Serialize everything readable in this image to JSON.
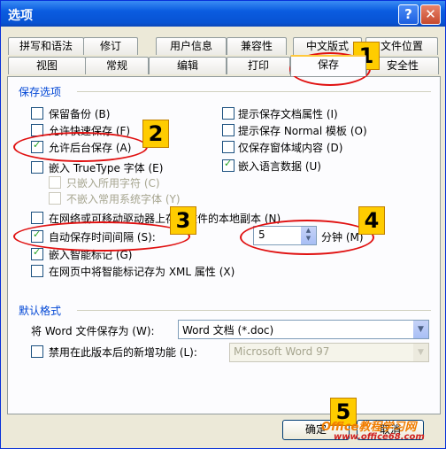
{
  "window": {
    "title": "选项",
    "help": "?",
    "close": "✕"
  },
  "tabs_row1": [
    "拼写和语法",
    "修订",
    "用户信息",
    "兼容性",
    "中文版式",
    "文件位置"
  ],
  "tabs_row2": [
    "视图",
    "常规",
    "编辑",
    "打印",
    "保存",
    "安全性"
  ],
  "save_options": {
    "header": "保存选项",
    "left": [
      {
        "label": "保留备份 (B)",
        "checked": false,
        "disabled": false
      },
      {
        "label": "允许快速保存 (F)",
        "checked": false,
        "disabled": false
      },
      {
        "label": "允许后台保存 (A)",
        "checked": true,
        "disabled": false
      },
      {
        "label": "嵌入 TrueType 字体 (E)",
        "checked": false,
        "disabled": false
      },
      {
        "label": "只嵌入所用字符 (C)",
        "checked": false,
        "disabled": true
      },
      {
        "label": "不嵌入常用系统字体 (Y)",
        "checked": false,
        "disabled": true
      }
    ],
    "right": [
      {
        "label": "提示保存文档属性 (I)",
        "checked": false
      },
      {
        "label": "提示保存 Normal 模板 (O)",
        "checked": false
      },
      {
        "label": "仅保存窗体域内容 (D)",
        "checked": false
      },
      {
        "label": "嵌入语言数据 (U)",
        "checked": true
      }
    ],
    "network_copy": {
      "label": "在网络或可移动驱动器上存储文件的本地副本 (N)",
      "checked": false
    },
    "autosave": {
      "label": "自动保存时间间隔 (S):",
      "checked": true,
      "value": "5",
      "unit": "分钟 (M)"
    },
    "smart_tags": {
      "label": "嵌入智能标记 (G)",
      "checked": true
    },
    "xml_tags": {
      "label": "在网页中将智能标记存为 XML 属性 (X)",
      "checked": false
    }
  },
  "default_format": {
    "header": "默认格式",
    "save_as_label": "将 Word 文件保存为 (W):",
    "save_as_value": "Word 文档 (*.doc)",
    "disable_label": "禁用在此版本后的新增功能 (L):",
    "disable_value": "Microsoft Word 97",
    "disable_checked": false
  },
  "footer": {
    "ok": "确定",
    "cancel": "取消"
  },
  "annotations": [
    "1",
    "2",
    "3",
    "4",
    "5"
  ],
  "watermark": {
    "line1": "Office教程学习网",
    "line2": "www.office68.com"
  },
  "colors": {
    "title_bar": "#0a5ce0",
    "ring": "#e01010",
    "badge": "#ffcc00",
    "active_tab": "#ffc83c"
  }
}
